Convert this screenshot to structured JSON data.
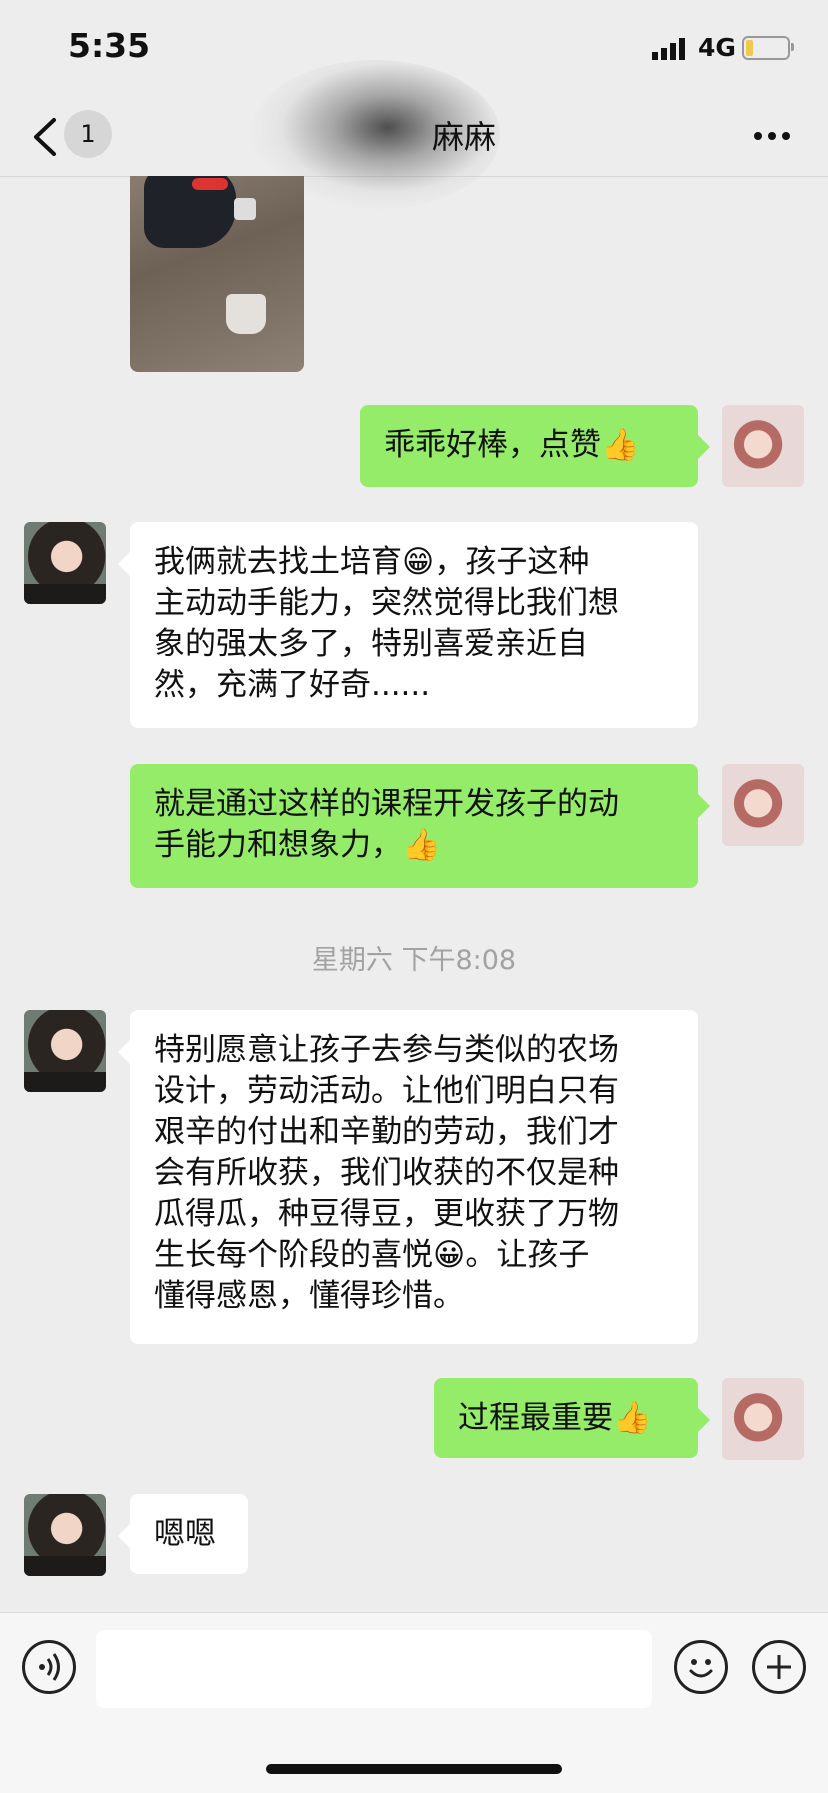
{
  "status_bar": {
    "time": "5:35",
    "network": "4G"
  },
  "nav": {
    "back_badge": "1",
    "title": "麻麻"
  },
  "messages": {
    "m1": "乖乖好棒，点赞👍",
    "m2": "我俩就去找土培育😁，孩子这种\n主动动手能力，突然觉得比我们想\n象的强太多了，特别喜爱亲近自\n然，充满了好奇......",
    "m3": "就是通过这样的课程开发孩子的动\n手能力和想象力，👍",
    "m4": "特别愿意让孩子去参与类似的农场\n设计，劳动活动。让他们明白只有\n艰辛的付出和辛勤的劳动，我们才\n会有所收获，我们收获的不仅是种\n瓜得瓜，种豆得豆，更收获了万物\n生长每个阶段的喜悦😀。让孩子\n懂得感恩，懂得珍惜。",
    "m5": "过程最重要👍",
    "m6": "嗯嗯"
  },
  "timestamp": "星期六 下午8:08",
  "icons": {
    "back": "chevron-left-icon",
    "more": "more-icon",
    "voice": "voice-icon",
    "emoji": "emoji-icon",
    "plus": "plus-icon"
  },
  "colors": {
    "outgoing_bubble": "#95ec69",
    "incoming_bubble": "#ffffff",
    "background": "#ededed"
  }
}
